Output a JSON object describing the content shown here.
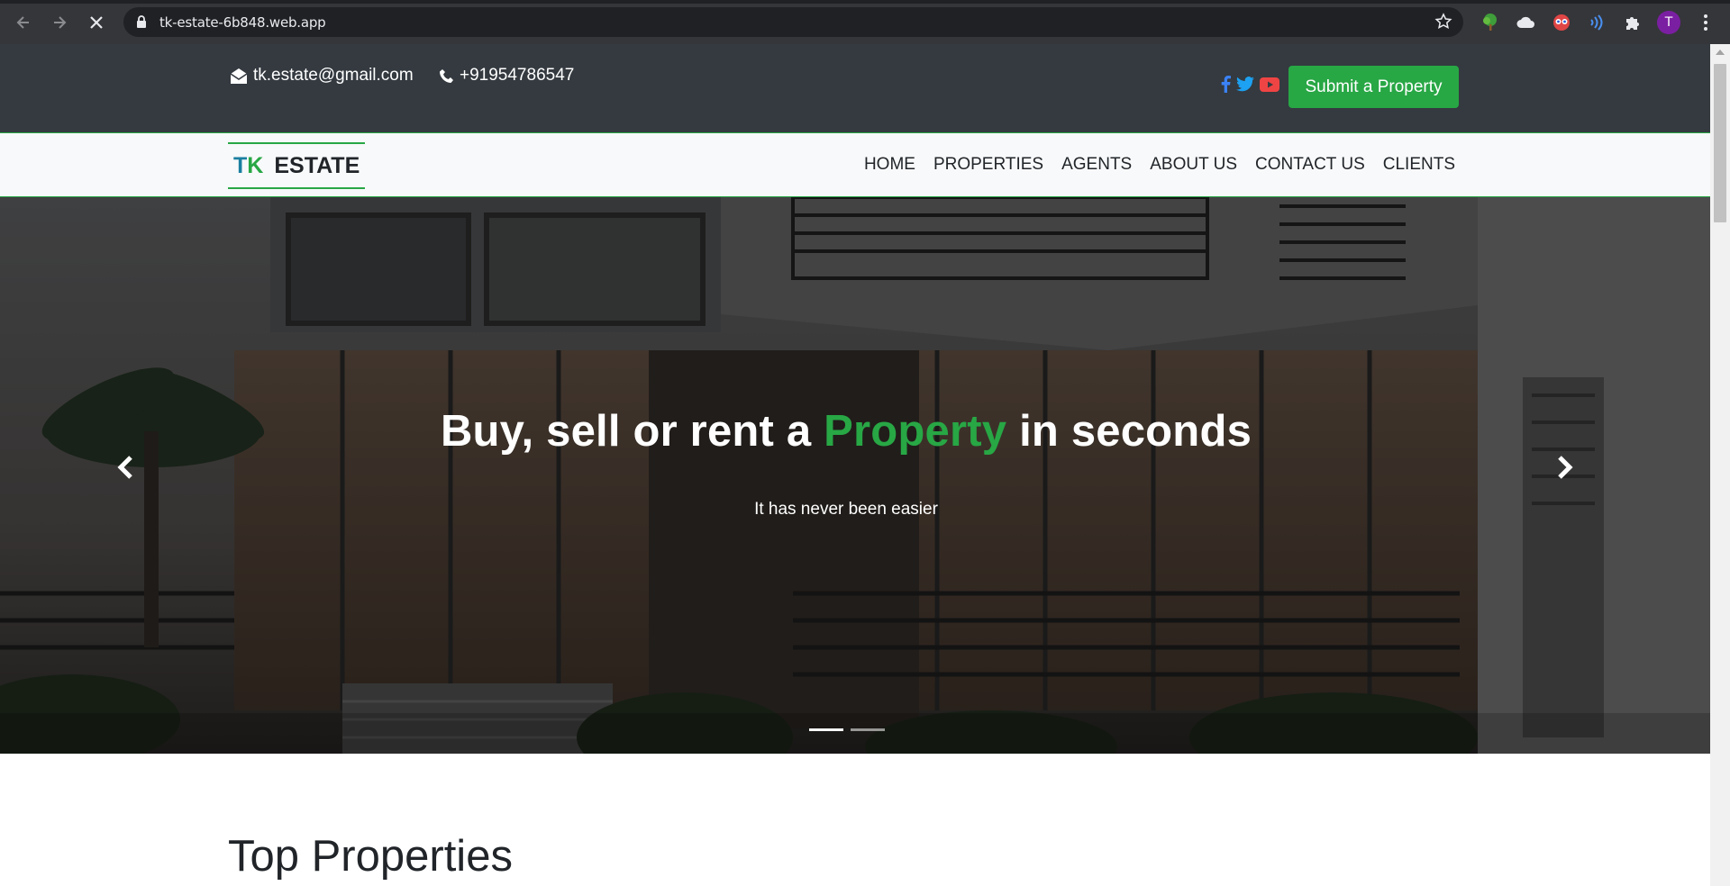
{
  "browser": {
    "url": "tk-estate-6b848.web.app",
    "profile_initial": "T",
    "icons": [
      "back-icon",
      "forward-icon",
      "stop-loading-icon",
      "lock-icon",
      "bookmark-star-icon",
      "tree-extension-icon",
      "cloud-extension-icon",
      "eyes-extension-icon",
      "sound-wave-extension-icon",
      "puzzle-extensions-icon",
      "more-menu-icon"
    ]
  },
  "topbar": {
    "email": "tk.estate@gmail.com",
    "phone": "+91954786547",
    "social_icons": [
      "facebook-icon",
      "twitter-icon",
      "youtube-icon"
    ],
    "submit_label": "Submit a Property"
  },
  "navbar": {
    "logo_tk_t": "T",
    "logo_tk_k": "K",
    "logo_estate": "ESTATE",
    "menu": [
      "HOME",
      "PROPERTIES",
      "AGENTS",
      "ABOUT US",
      "CONTACT US",
      "CLIENTS"
    ]
  },
  "hero": {
    "title_before": "Buy, sell or rent a ",
    "title_accent": "Property",
    "title_after": " in seconds",
    "subtitle": "It has never been easier",
    "slides": 2,
    "active_slide": 1
  },
  "sections": {
    "top_properties_title": "Top Properties"
  },
  "colors": {
    "accent": "#28a745",
    "dark": "#343a40",
    "logo_blue": "#1a7fa0",
    "facebook": "#3b82f6",
    "twitter": "#1da1f2",
    "youtube": "#ef4444"
  }
}
